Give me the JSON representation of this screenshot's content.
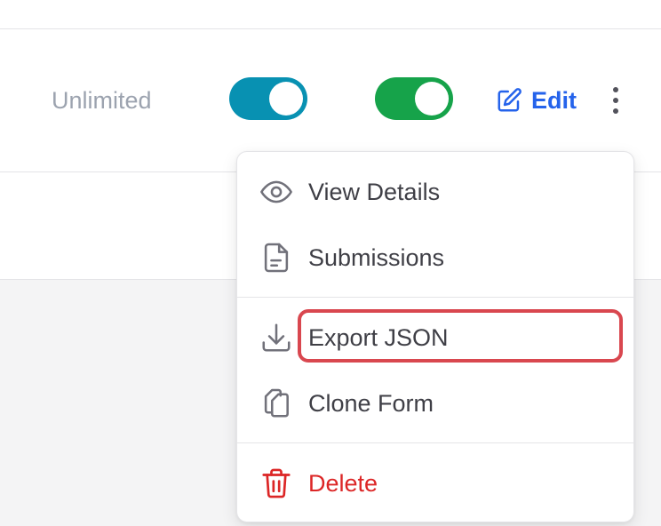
{
  "row": {
    "limit_label": "Unlimited",
    "toggle_1": {
      "state": "on",
      "color": "#0891b2"
    },
    "toggle_2": {
      "state": "on",
      "color": "#16a34a"
    },
    "edit_label": "Edit",
    "edit_color": "#2563eb"
  },
  "menu": {
    "items": [
      {
        "label": "View Details",
        "icon": "eye-icon"
      },
      {
        "label": "Submissions",
        "icon": "document-icon"
      },
      {
        "label": "Export JSON",
        "icon": "download-icon",
        "highlighted": true
      },
      {
        "label": "Clone Form",
        "icon": "copy-icon"
      },
      {
        "label": "Delete",
        "icon": "trash-icon",
        "danger": true
      }
    ],
    "danger_color": "#dc2626",
    "highlight_color": "#d9474f"
  }
}
